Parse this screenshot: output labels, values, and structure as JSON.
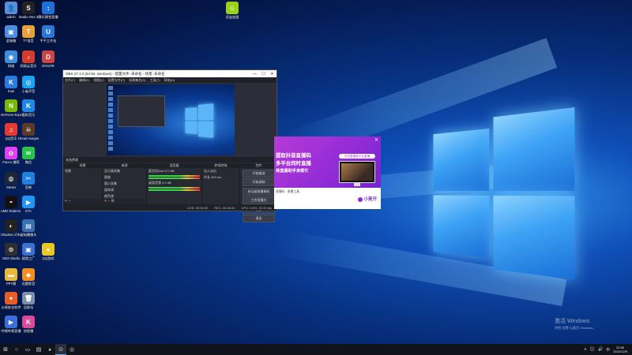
{
  "desktop": {
    "icons": [
      {
        "id": "admin",
        "label": "admin",
        "glyph": "👤",
        "color": "#5a8fd6"
      },
      {
        "id": "studio-one",
        "label": "Studio One 3",
        "glyph": "S",
        "color": "#222"
      },
      {
        "id": "teamviewer",
        "label": "腾讯课堂直播",
        "glyph": "↕",
        "color": "#1f6fd8"
      },
      {
        "id": "pc",
        "label": "此电脑",
        "glyph": "▣",
        "color": "#4a8ee0"
      },
      {
        "id": "tuquan",
        "label": "TT语音",
        "glyph": "T",
        "color": "#e5a13c"
      },
      {
        "id": "fs",
        "label": "平平工作台",
        "glyph": "U",
        "color": "#2a77d8"
      },
      {
        "id": "net",
        "label": "网络",
        "glyph": "◉",
        "color": "#3d8fd9"
      },
      {
        "id": "netease",
        "label": "网易云音乐",
        "glyph": "♪",
        "color": "#d33b2f"
      },
      {
        "id": "dou",
        "label": "DOUOR",
        "glyph": "D",
        "color": "#c44"
      },
      {
        "id": "kuai",
        "label": "Kuai",
        "glyph": "K",
        "color": "#2a7be0"
      },
      {
        "id": "xiaomi",
        "label": "小雀声音",
        "glyph": "◎",
        "color": "#1da1f2"
      },
      {
        "id": "geforce",
        "label": "GeForce Experience",
        "glyph": "N",
        "color": "#76b900"
      },
      {
        "id": "kugou",
        "label": "酷狗音乐",
        "glyph": "K",
        "color": "#1e88e5"
      },
      {
        "id": "music",
        "label": "QQ音乐",
        "glyph": "♫",
        "color": "#e53935"
      },
      {
        "id": "dread",
        "label": "Dread Hunger",
        "glyph": "☠",
        "color": "#5b3a2a"
      },
      {
        "id": "faceu",
        "label": "Faceu 激萌",
        "glyph": "✿",
        "color": "#e040fb"
      },
      {
        "id": "wechat",
        "label": "微信",
        "glyph": "✉",
        "color": "#2bc24b"
      },
      {
        "id": "steam",
        "label": "Steam",
        "glyph": "◍",
        "color": "#1b2838"
      },
      {
        "id": "jianying",
        "label": "剪映",
        "glyph": "✂",
        "color": "#1f80e0"
      },
      {
        "id": "ktc",
        "label": "KTC",
        "glyph": "▶",
        "color": "#2196f3"
      },
      {
        "id": "amd",
        "label": "AMD Radeon Software",
        "glyph": "◓",
        "color": "#111"
      },
      {
        "id": "vcam",
        "label": "虚拟摄像头",
        "glyph": "▤",
        "color": "#3a6fb0"
      },
      {
        "id": "shadow",
        "label": "Shadow of the Tomb",
        "glyph": "◐",
        "color": "#222"
      },
      {
        "id": "obs",
        "label": "OBS Studio",
        "glyph": "⊙",
        "color": "#302e31"
      },
      {
        "id": "movie",
        "label": "视频工厂",
        "glyph": "▣",
        "color": "#3a70d0"
      },
      {
        "id": "qqmusic",
        "label": "QQ游戏",
        "glyph": "●",
        "color": "#e8c821"
      },
      {
        "id": "folder",
        "label": "PPT模",
        "glyph": "▬",
        "color": "#e8b93a"
      },
      {
        "id": "thunder",
        "label": "迅雷影音",
        "glyph": "◆",
        "color": "#f28d1f"
      },
      {
        "id": "anydesk",
        "label": "火绒安全软件",
        "glyph": "✦",
        "color": "#e85c28"
      },
      {
        "id": "recycle",
        "label": "回收站",
        "glyph": "🗑",
        "color": "#7a8fa8"
      },
      {
        "id": "xuanxue",
        "label": "哔哩哔哩直播",
        "glyph": "▶",
        "color": "#3b6ed8"
      },
      {
        "id": "kuaiz",
        "label": "快直播",
        "glyph": "K",
        "color": "#d84a9b"
      },
      {
        "id": "top-center",
        "label": "迅连加速",
        "glyph": "☺",
        "color": "#9ad11c"
      }
    ]
  },
  "obs": {
    "title": "OBS 27.1.3 (64-bit, windows) - 配置文件: 未命名 - 场景: 未命名",
    "window_buttons": [
      "—",
      "☐",
      "✕"
    ],
    "menu": [
      "文件(F)",
      "编辑(E)",
      "视图(V)",
      "配置文件(P)",
      "场景集合(S)",
      "工具(T)",
      "帮助(H)"
    ],
    "context_bar": "未选择源",
    "docks": {
      "scenes": {
        "title": "场景",
        "items": [
          "场景"
        ]
      },
      "sources": {
        "title": "来源",
        "items": [
          "显示器采集",
          "图像",
          "窗口采集",
          "媒体源",
          "颜色源"
        ]
      },
      "mixer": {
        "title": "混音器",
        "items": [
          "麦克风/Aux",
          "桌面音频"
        ],
        "levels": [
          "0.0 dB",
          "0.0 dB"
        ]
      },
      "transitions": {
        "title": "转场特效",
        "items": [
          "淡入淡出",
          "时长"
        ],
        "duration": "300 ms"
      },
      "controls": {
        "title": "控件",
        "buttons": [
          "开始推流",
          "开始录制",
          "启动虚拟摄像机",
          "工作室模式",
          "设置",
          "退出"
        ]
      }
    },
    "status": {
      "live": "LIVE: 00:00:00",
      "rec": "REC: 00:00:00",
      "cpu": "CPU: 0.6%, 30.00 fps"
    }
  },
  "ad": {
    "line1": "提取抖音直播码",
    "line2": "多平台同时直播",
    "line3": "商直播助手来帮忙",
    "pill": "在线直播各平台直播",
    "tabs": "直播码 · 直播工具",
    "brand": "小麦开",
    "close": "✕",
    "colors": {
      "primary": "#8f2bd6",
      "accent": "#b73ad8"
    }
  },
  "watermark": {
    "line1": "激活 Windows",
    "line2": "转到\"设置\"以激活 Windows。"
  },
  "taskbar": {
    "items": [
      {
        "name": "start",
        "glyph": "⊞"
      },
      {
        "name": "search",
        "glyph": "○"
      },
      {
        "name": "task-view",
        "glyph": "▭"
      },
      {
        "name": "explorer",
        "glyph": "▤"
      },
      {
        "name": "edge",
        "glyph": "◕"
      },
      {
        "name": "obs",
        "glyph": "⊙"
      },
      {
        "name": "chrome",
        "glyph": "◎"
      }
    ],
    "clock_time": "22:56",
    "clock_date": "2022/12/9",
    "tray": [
      "∧",
      "⬛",
      "🔊",
      "中"
    ]
  }
}
